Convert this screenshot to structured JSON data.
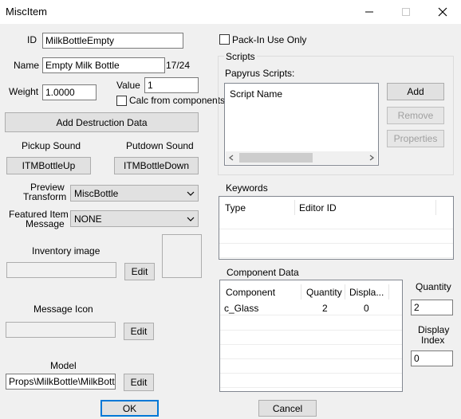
{
  "window": {
    "title": "MiscItem"
  },
  "fields": {
    "id_label": "ID",
    "id_value": "MilkBottleEmpty",
    "name_label": "Name",
    "name_value": "Empty Milk Bottle",
    "name_count": "17/24",
    "weight_label": "Weight",
    "weight_value": "1.0000",
    "value_label": "Value",
    "value_value": "1",
    "calc_label": "Calc from components"
  },
  "destruction": {
    "label": "Add Destruction Data"
  },
  "sounds": {
    "pickup_label": "Pickup Sound",
    "pickup_value": "ITMBottleUp",
    "putdown_label": "Putdown Sound",
    "putdown_value": "ITMBottleDown"
  },
  "preview": {
    "label_line1": "Preview",
    "label_line2": "Transform",
    "value": "MiscBottle"
  },
  "featured": {
    "label_line1": "Featured Item",
    "label_line2": "Message",
    "value": "NONE"
  },
  "inventory_image": {
    "label": "Inventory image",
    "edit": "Edit"
  },
  "message_icon": {
    "label": "Message Icon",
    "edit": "Edit"
  },
  "model": {
    "label": "Model",
    "value": "Props\\MilkBottle\\MilkBottleEmpty",
    "edit": "Edit"
  },
  "pack_in": {
    "label": "Pack-In Use Only"
  },
  "scripts": {
    "group_label": "Scripts",
    "papyrus_label": "Papyrus Scripts:",
    "column": "Script Name",
    "add": "Add",
    "remove": "Remove",
    "properties": "Properties"
  },
  "keywords": {
    "group_label": "Keywords",
    "columns": [
      "Type",
      "Editor ID"
    ]
  },
  "components": {
    "group_label": "Component Data",
    "columns": [
      "Component",
      "Quantity",
      "Displa..."
    ],
    "rows": [
      {
        "component": "c_Glass",
        "quantity": "2",
        "display": "0"
      }
    ],
    "quantity_label": "Quantity",
    "quantity_value": "2",
    "display_label_line1": "Display",
    "display_label_line2": "Index",
    "display_value": "0"
  },
  "footer": {
    "ok": "OK",
    "cancel": "Cancel"
  }
}
